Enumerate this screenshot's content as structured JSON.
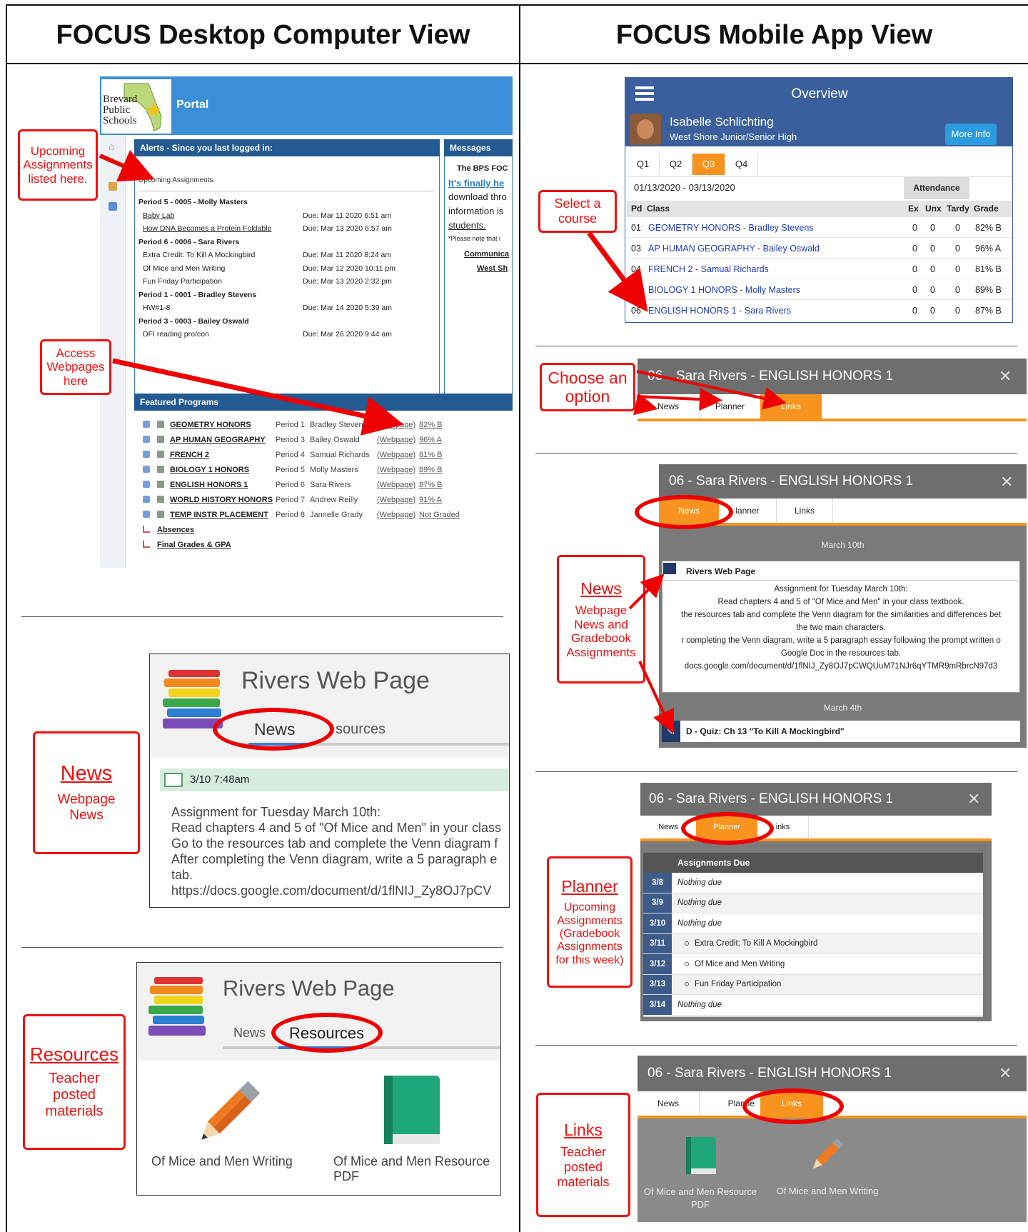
{
  "headers": {
    "desktop": "FOCUS Desktop Computer View",
    "mobile": "FOCUS Mobile App View"
  },
  "portal": {
    "logo_lines": [
      "Brevard",
      "Public",
      "Schools"
    ],
    "title": "Portal",
    "alerts_title": "Alerts - Since you last logged in:",
    "messages_title": "Messages",
    "upcoming_label": "Upcoming Assignments:",
    "assignments": [
      {
        "kind": "period",
        "text": "Period 5 - 0005 - Molly Masters"
      },
      {
        "kind": "item",
        "text": "Baby Lab",
        "due": "Due: Mar 11 2020 6:51 am",
        "link": true
      },
      {
        "kind": "item",
        "text": "How DNA Becomes a Protein Foldable",
        "due": "Due: Mar 13 2020 6:57 am",
        "link": true
      },
      {
        "kind": "period",
        "text": "Period 6 - 0006 - Sara Rivers"
      },
      {
        "kind": "item",
        "text": "Extra Credit: To Kill A Mockingbird",
        "due": "Due: Mar 11 2020 8:24 am",
        "link": false
      },
      {
        "kind": "item",
        "text": "Of Mice and Men Writing",
        "due": "Due: Mar 12 2020 10:11 pm",
        "link": false
      },
      {
        "kind": "item",
        "text": "Fun Friday Participation",
        "due": "Due: Mar 13 2020 2:32 pm",
        "link": false
      },
      {
        "kind": "period",
        "text": "Period 1 - 0001 - Bradley Stevens"
      },
      {
        "kind": "item",
        "text": "HW#1-8",
        "due": "Due: Mar 14 2020 5:39 am",
        "link": false
      },
      {
        "kind": "period",
        "text": "Period 3 - 0003 - Bailey Oswald"
      },
      {
        "kind": "item",
        "text": "DFI reading pro/con",
        "due": "Due: Mar 26 2020 9:44 am",
        "link": false
      }
    ],
    "messages": {
      "line1": "The BPS FOC",
      "line2": "It's finally he",
      "line3": "download thro",
      "line4": "information is",
      "line5": "students.",
      "line6": "*Please note that i",
      "line7": "Communica",
      "line8": "West Sh"
    },
    "featured_title": "Featured Programs",
    "courses": [
      {
        "name": "GEOMETRY HONORS",
        "period": "Period 1",
        "teacher": "Bradley Stevens",
        "web": "(Webpage)",
        "grade": "82% B"
      },
      {
        "name": "AP HUMAN GEOGRAPHY",
        "period": "Period 3",
        "teacher": "Bailey Oswald",
        "web": "(Webpage)",
        "grade": "96% A"
      },
      {
        "name": "FRENCH 2",
        "period": "Period 4",
        "teacher": "Samual Richards",
        "web": "(Webpage)",
        "grade": "81% B"
      },
      {
        "name": "BIOLOGY 1 HONORS",
        "period": "Period 5",
        "teacher": "Molly Masters",
        "web": "(Webpage)",
        "grade": "89% B"
      },
      {
        "name": "ENGLISH HONORS 1",
        "period": "Period 6",
        "teacher": "Sara Rivers",
        "web": "(Webpage)",
        "grade": "87% B"
      },
      {
        "name": "WORLD HISTORY HONORS",
        "period": "Period 7",
        "teacher": "Andrew Reilly",
        "web": "(Webpage)",
        "grade": "91% A"
      },
      {
        "name": "TEMP INSTR PLACEMENT",
        "period": "Period 8",
        "teacher": "Jannelle Grady",
        "web": "(Webpage)",
        "grade": "Not Graded"
      }
    ],
    "extras": [
      "Absences",
      "Final Grades & GPA"
    ]
  },
  "callouts": {
    "upcoming": "Upcoming Assignments listed here.",
    "access": "Access Webpages here",
    "news_title": "News",
    "news_sub": "Webpage News",
    "resources_title": "Resources",
    "resources_sub": "Teacher posted materials",
    "select": "Select a course",
    "choose": "Choose an option",
    "m_news_title": "News",
    "m_news_sub": "Webpage News and Gradebook Assignments",
    "planner_title": "Planner",
    "planner_sub": "Upcoming Assignments (Gradebook Assignments for this week)",
    "links_title": "Links",
    "links_sub": "Teacher posted materials"
  },
  "webpage": {
    "title": "Rivers Web Page",
    "tab_news": "News",
    "tab_resources": "Resources",
    "tab_resources_clipped": "sources",
    "post_time": "3/10 7:48am",
    "post_lines": [
      "Assignment for Tuesday March 10th:",
      "Read chapters 4 and 5 of \"Of Mice and Men\" in your class",
      "Go to the resources tab and complete the Venn diagram f",
      "After completing the Venn diagram, write a 5 paragraph e",
      "tab.",
      "https://docs.google.com/document/d/1flNIJ_Zy8OJ7pCV"
    ],
    "res1": "Of Mice and Men Writing",
    "res2": "Of Mice and Men Resource PDF"
  },
  "overview": {
    "title": "Overview",
    "student": "Isabelle Schlichting",
    "school": "West Shore Junior/Senior High",
    "more_info": "More Info",
    "quarters": [
      "Q1",
      "Q2",
      "Q3",
      "Q4"
    ],
    "active_quarter": "Q3",
    "range": "01/13/2020 - 03/13/2020",
    "attendance": "Attendance",
    "cols": [
      "Pd",
      "Class",
      "Ex",
      "Unx",
      "Tardy",
      "Grade"
    ],
    "rows": [
      {
        "pd": "01",
        "cls": "GEOMETRY HONORS - Bradley Stevens",
        "ex": "0",
        "unx": "0",
        "tardy": "0",
        "grade": "82% B"
      },
      {
        "pd": "03",
        "cls": "AP HUMAN GEOGRAPHY - Bailey Oswald",
        "ex": "0",
        "unx": "0",
        "tardy": "0",
        "grade": "96% A"
      },
      {
        "pd": "04",
        "cls": "FRENCH 2 - Samual Richards",
        "ex": "0",
        "unx": "0",
        "tardy": "0",
        "grade": "81% B"
      },
      {
        "pd": "",
        "cls": "BIOLOGY 1 HONORS - Molly Masters",
        "ex": "0",
        "unx": "0",
        "tardy": "0",
        "grade": "89% B"
      },
      {
        "pd": "06",
        "cls": "ENGLISH HONORS 1 - Sara Rivers",
        "ex": "0",
        "unx": "0",
        "tardy": "0",
        "grade": "87% B"
      }
    ]
  },
  "course_header": {
    "title": "06 - Sara Rivers - ENGLISH HONORS 1",
    "clipped": "Sara Rivers - ENGLISH HONORS 1",
    "clipped_prefix": "06",
    "tabs": [
      "News",
      "Planner",
      "Links"
    ],
    "tab_planner_clipped": "lanner",
    "tab_links_clipped": "inks",
    "tab_planner_clipped2": "Planne",
    "close": "✕"
  },
  "m_news": {
    "date1": "March 10th",
    "card_title": "Rivers Web Page",
    "lines": [
      "Assignment for Tuesday March 10th:",
      "Read chapters 4 and 5 of \"Of Mice and Men\" in your class textbook.",
      "the resources tab and complete the Venn diagram for the similarities and differences bet",
      "the two main characters.",
      "r completing the Venn diagram, write a 5 paragraph essay following the prompt written o",
      "Google Doc in the resources tab.",
      "docs.google.com/document/d/1flNIJ_Zy8OJ7pCWQUuM71NJr6qYTMR9mRbrcN97d3"
    ],
    "date2": "March 4th",
    "quiz": "D - Quiz: Ch 13 \"To Kill A Mockingbird\""
  },
  "planner": {
    "header": "Assignments Due",
    "rows": [
      {
        "date": "3/8",
        "text": "Nothing due",
        "bullet": false
      },
      {
        "date": "3/9",
        "text": "Nothing due",
        "bullet": false
      },
      {
        "date": "3/10",
        "text": "Nothing due",
        "bullet": false
      },
      {
        "date": "3/11",
        "text": "Extra Credit: To Kill A Mockingbird",
        "bullet": true
      },
      {
        "date": "3/12",
        "text": "Of Mice and Men Writing",
        "bullet": true
      },
      {
        "date": "3/13",
        "text": "Fun Friday Participation",
        "bullet": true
      },
      {
        "date": "3/14",
        "text": "Nothing due",
        "bullet": false
      }
    ]
  },
  "links": {
    "item1": "Of Mice and Men Resource PDF",
    "item2": "Of Mice and Men Writing"
  },
  "colors": {
    "red": "#e11111",
    "orange": "#f7931e",
    "portal_blue": "#3a8fd8",
    "header_gray": "#6e6e6e"
  }
}
